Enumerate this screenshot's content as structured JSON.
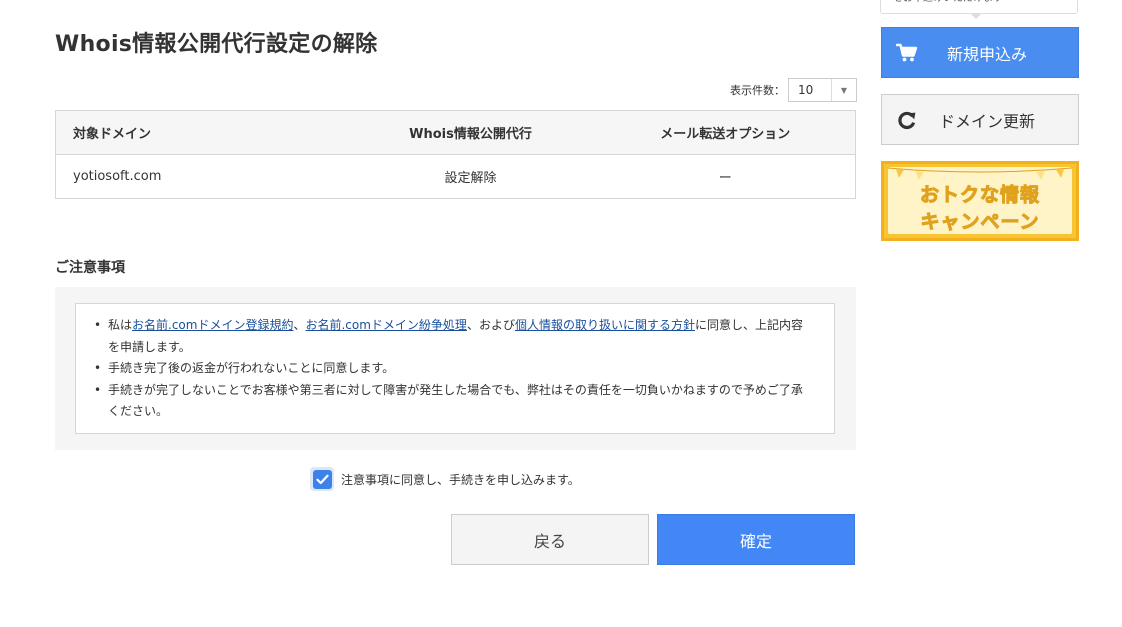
{
  "page": {
    "title": "Whois情報公開代行設定の解除"
  },
  "per_page": {
    "label": "表示件数：",
    "value": "10"
  },
  "table": {
    "headers": {
      "domain": "対象ドメイン",
      "whois": "Whois情報公開代行",
      "mail": "メール転送オプション"
    },
    "rows": [
      {
        "domain": "yotiosoft.com",
        "whois": "設定解除",
        "mail": "ー"
      }
    ]
  },
  "notes": {
    "title": "ご注意事項",
    "items": [
      {
        "prefix": "私は",
        "link1": "お名前.comドメイン登録規約",
        "sep1": "、",
        "link2": "お名前.comドメイン紛争処理",
        "sep2": "、および",
        "link3": "個人情報の取り扱いに関する方針",
        "suffix": "に同意し、上記内容を申請します。"
      },
      {
        "text": "手続き完了後の返金が行われないことに同意します。"
      },
      {
        "text": "手続きが完了しないことでお客様や第三者に対して障害が発生した場合でも、弊社はその責任を一切負いかねますので予めご了承ください。"
      }
    ]
  },
  "agreement": {
    "label": "注意事項に同意し、手続きを申し込みます。",
    "checked": true
  },
  "buttons": {
    "back": "戻る",
    "confirm": "確定"
  },
  "sidebar": {
    "tooltip": "をお申込みいただけます",
    "new_order": {
      "label": "新規申込み",
      "icon": "cart-icon"
    },
    "renew": {
      "label": "ドメイン更新",
      "icon": "refresh-icon"
    },
    "promo": {
      "line1": "おトクな情報",
      "line2": "キャンペーン"
    }
  },
  "colors": {
    "primary_blue": "#4287f5",
    "link": "#1a4f9c",
    "promo_yellow": "#f9c432"
  }
}
